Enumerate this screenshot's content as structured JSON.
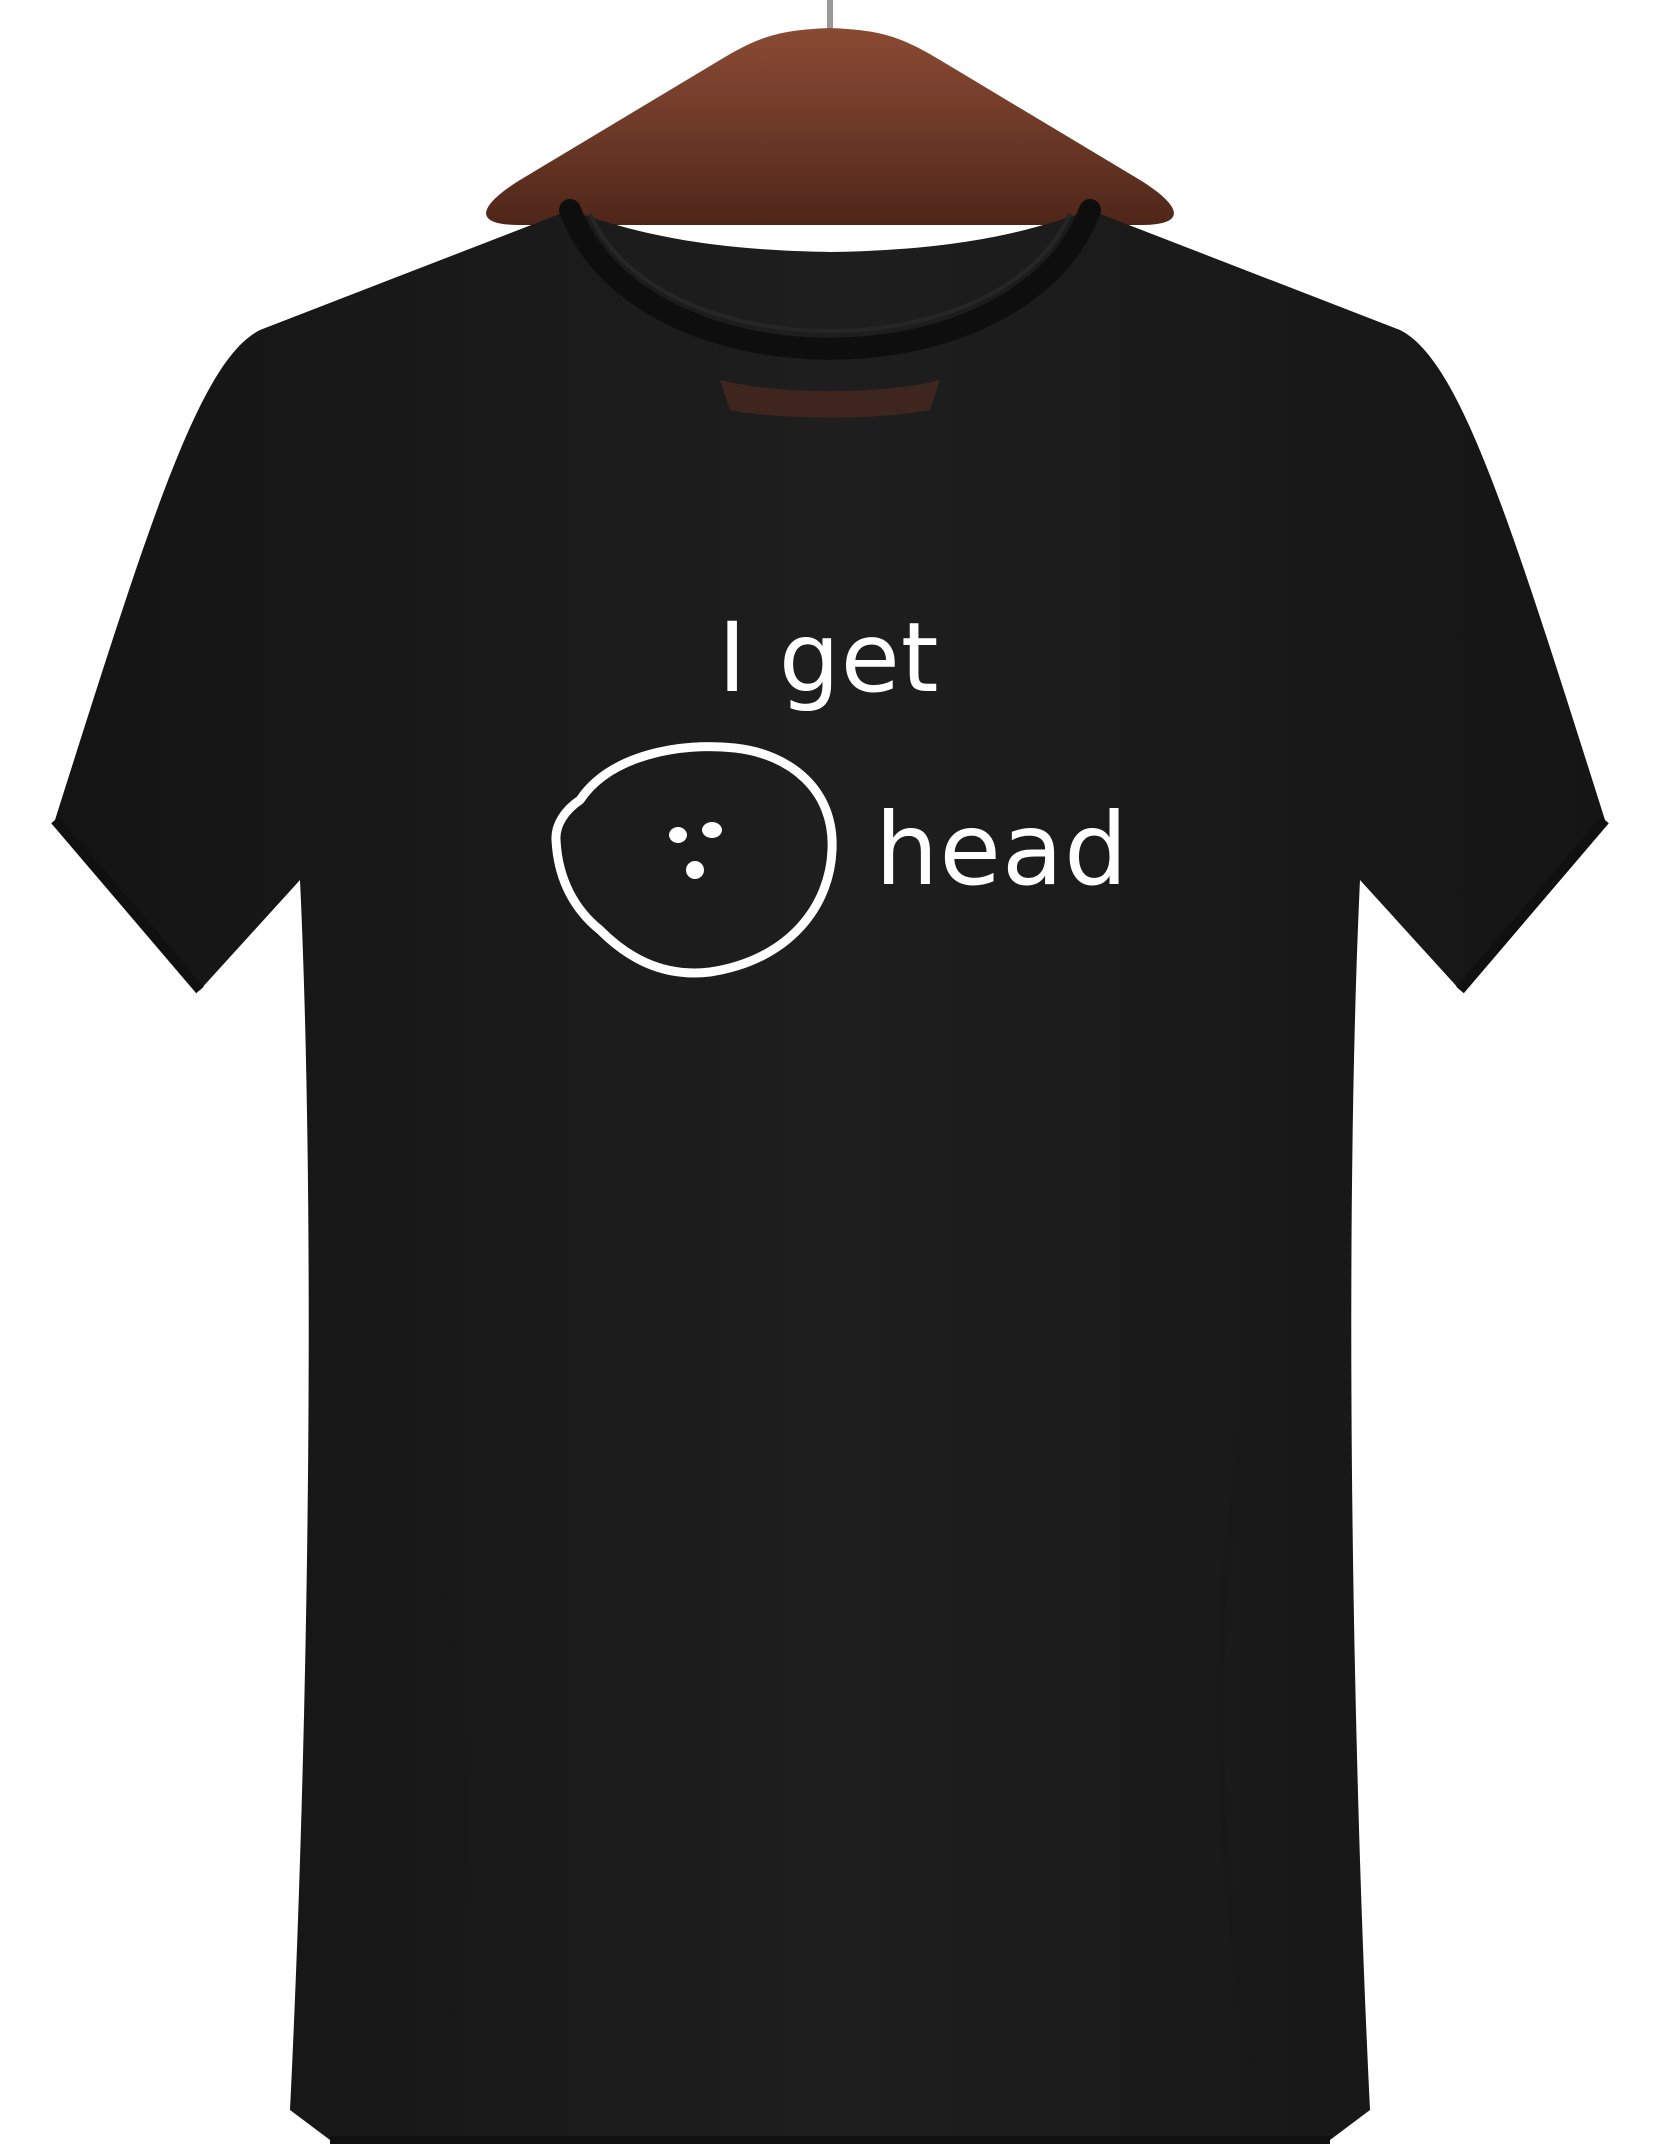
{
  "print": {
    "line_one": "I get",
    "line_two": "head",
    "doodle_icon": "round-face-doodle-icon",
    "ink_color": "#ffffff"
  },
  "garment": {
    "type": "t-shirt",
    "color": "#1b1b1b",
    "hanger_color": "#6e3a28",
    "hook_color": "#9a9a9a"
  },
  "background_color": "#ffffff"
}
